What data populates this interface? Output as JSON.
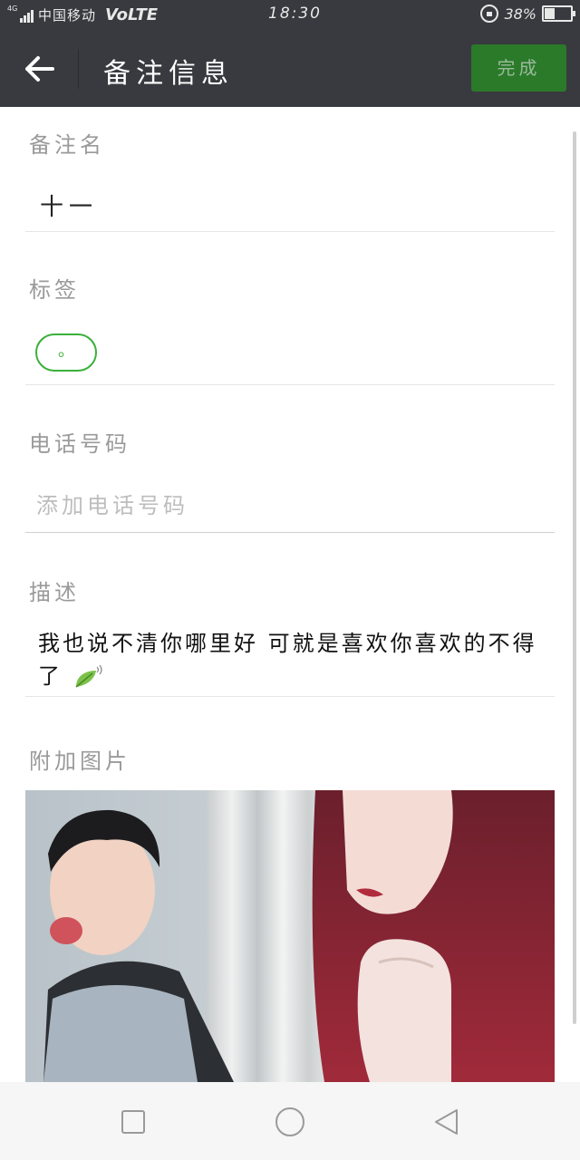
{
  "status_bar": {
    "network_badge": "4G",
    "carrier": "中国移动",
    "volte": "VoLTE",
    "time": "18:30",
    "battery_percent_text": "38%",
    "battery_level": 0.38
  },
  "header": {
    "title": "备注信息",
    "done_label": "完成",
    "back_icon": "arrow-left-icon"
  },
  "form": {
    "remark": {
      "label": "备注名",
      "value": "十一"
    },
    "tags": {
      "label": "标签",
      "tag_text": "。"
    },
    "phone": {
      "label": "电话号码",
      "placeholder": "添加电话号码"
    },
    "description": {
      "label": "描述",
      "text": "我也说不清你哪里好 可就是喜欢你喜欢的不得了",
      "icon": "leaf-emoji-icon"
    },
    "photo": {
      "label": "附加图片"
    }
  },
  "colors": {
    "header_bg": "#393a3f",
    "accent_green": "#3ab03a",
    "done_button_bg": "#2a7a2a"
  },
  "navbar": {
    "icons": [
      "recent-apps-icon",
      "home-icon",
      "back-icon"
    ]
  }
}
